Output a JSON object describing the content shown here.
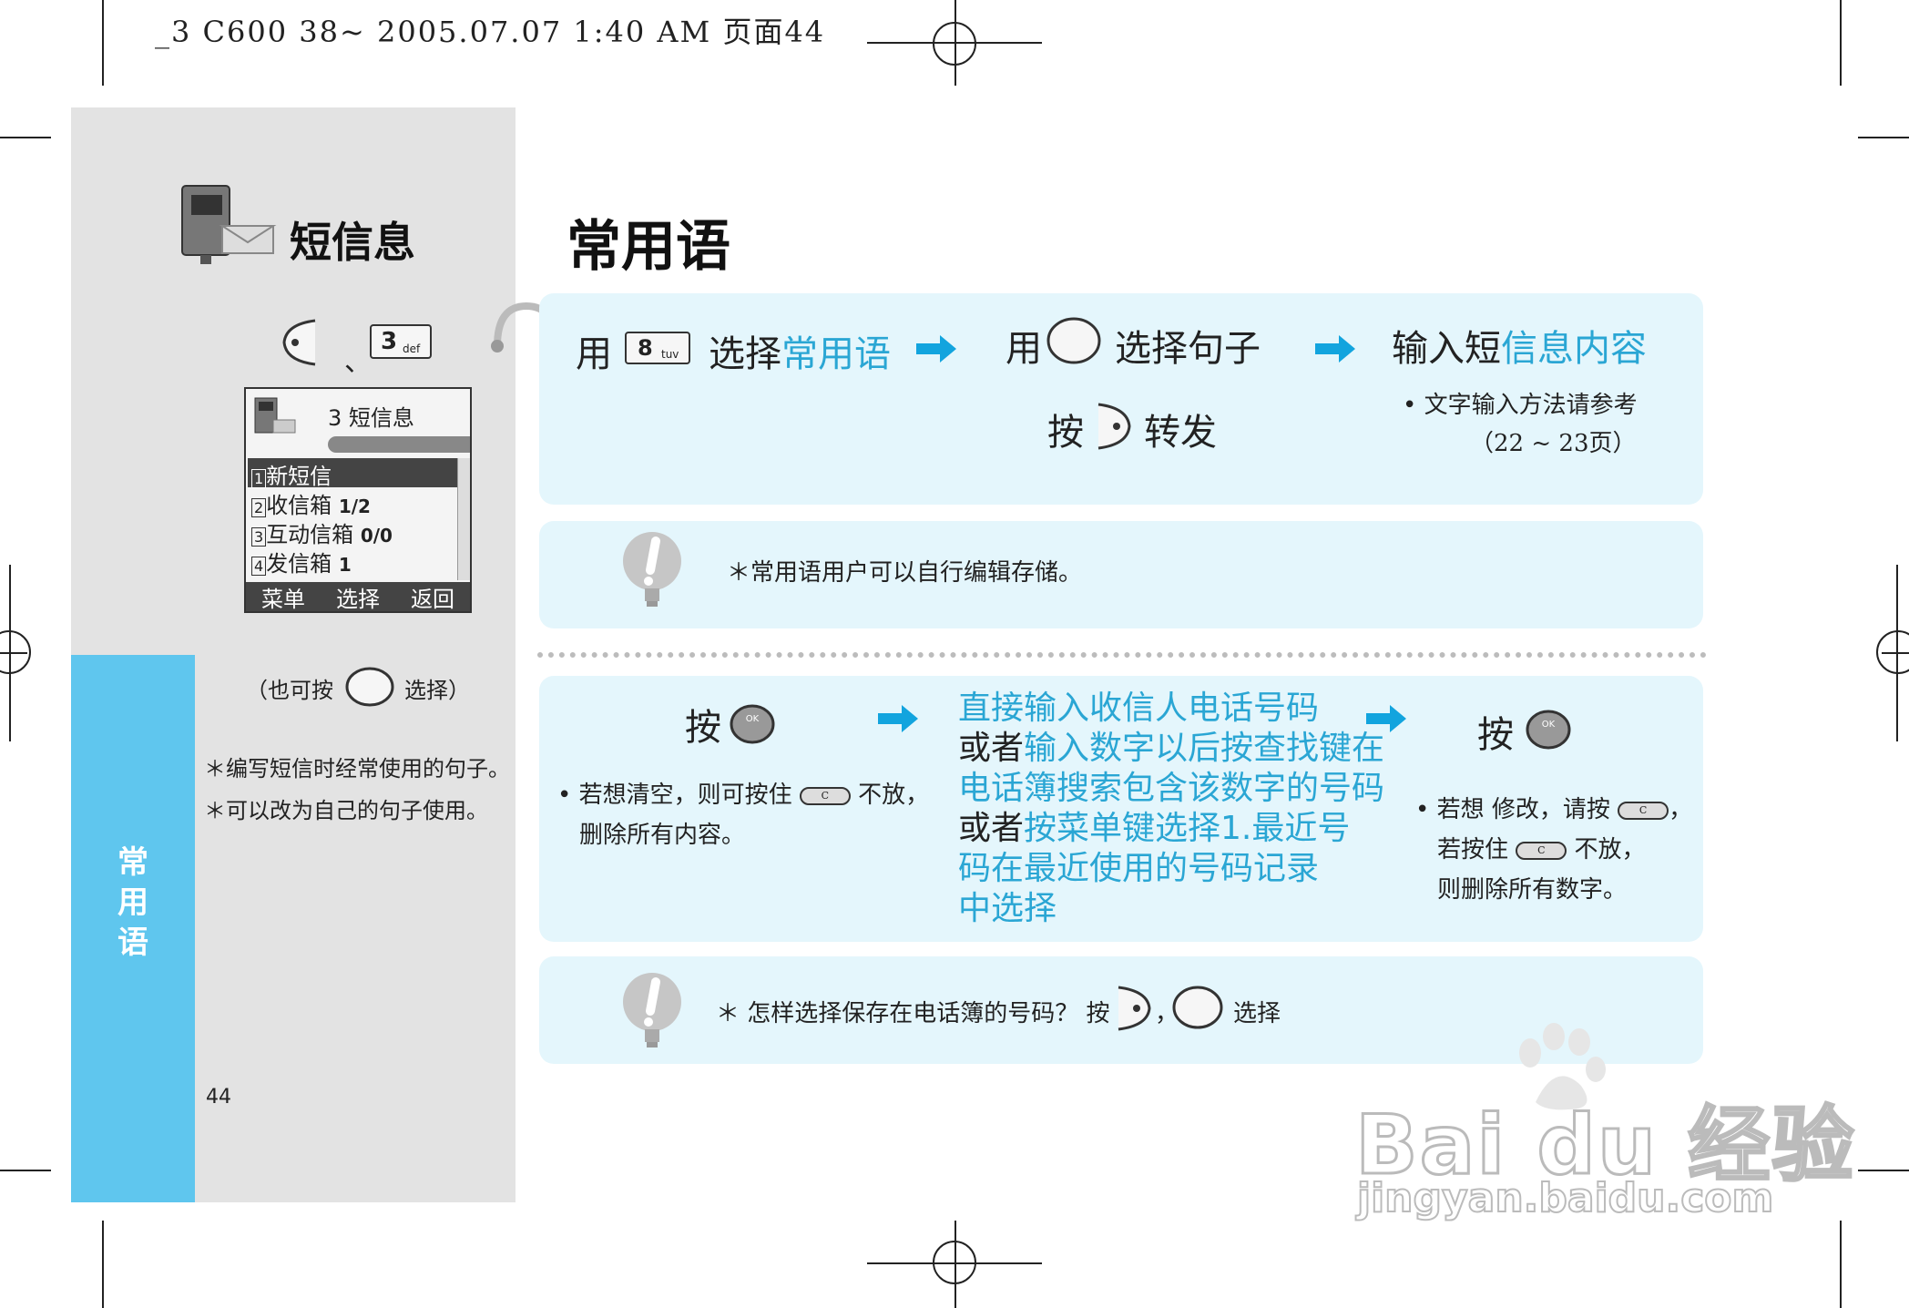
{
  "header": {
    "line": "_3 C600 38~ 2005.07.07 1:40 AM 页面44"
  },
  "sidebar": {
    "section_title": "短信息",
    "key_separator": "、",
    "key3_main": "3",
    "key3_sub": "def",
    "screen": {
      "title": "3 短信息",
      "items": [
        {
          "num": "1",
          "label": "新短信",
          "value": ""
        },
        {
          "num": "2",
          "label": "收信箱",
          "value": "1/2"
        },
        {
          "num": "3",
          "label": "互动信箱",
          "value": "0/0"
        },
        {
          "num": "4",
          "label": "发信箱",
          "value": "1"
        }
      ],
      "softkeys": [
        "菜单",
        "选择",
        "返回"
      ]
    },
    "also_press_prefix": "（也可按",
    "also_press_suffix": "选择）",
    "notes": [
      "＊编写短信时经常使用的句子。",
      "＊可以改为自己的句子使用。"
    ],
    "tab_label": "常用语",
    "page_number": "44"
  },
  "main": {
    "title": "常用语",
    "step1": {
      "use": "用",
      "key8_main": "8",
      "key8_sub": "tuv",
      "select": "选择",
      "select_blue": "常用语",
      "use2": "用",
      "select_sentence": "选择句子",
      "press": "按",
      "forward": "转发",
      "input_prefix": "输入短",
      "input_blue": "信息内容",
      "ref_line1": "• 文字输入方法请参考",
      "ref_line2": "（22 ~ 23页）"
    },
    "tip1": "＊常用语用户可以自行编辑存储。",
    "step2": {
      "press": "按",
      "clear_a": "• 若想清空，则可按住",
      "clear_b": "不放，",
      "clear_c": "删除所有内容。",
      "desc": [
        {
          "text": "直接输入收信人电话号码",
          "blue": true
        },
        {
          "prefix": "或者",
          "text": "输入数字以后按查找键在",
          "blue": true
        },
        {
          "text": "电话簿搜索包含该数字的号码",
          "blue": true
        },
        {
          "prefix": "或者",
          "text": "按菜单键选择1.最近号",
          "blue": true
        },
        {
          "text": "码在最近使用的号码记录",
          "blue": true
        },
        {
          "text": "中选择",
          "blue": true
        }
      ],
      "press2": "按",
      "modify_a": "• 若想 修改，请按",
      "modify_b": "，",
      "modify_c": "若按住",
      "modify_d": "不放，",
      "modify_e": "则删除所有数字。",
      "c_key": "C",
      "ok_key": "OK"
    },
    "tip2_a": "＊ 怎样选择保存在电话簿的号码？ 按",
    "tip2_b": "，",
    "tip2_c": "选择"
  },
  "watermark": {
    "brand": "Bai du 经验",
    "url": "jingyan.baidu.com"
  },
  "colors": {
    "accent_blue": "#2aa6d4",
    "tab_blue": "#5fc6ee",
    "panel_bg": "#e4f6fc",
    "sidebar_gray": "#e3e3e3"
  }
}
